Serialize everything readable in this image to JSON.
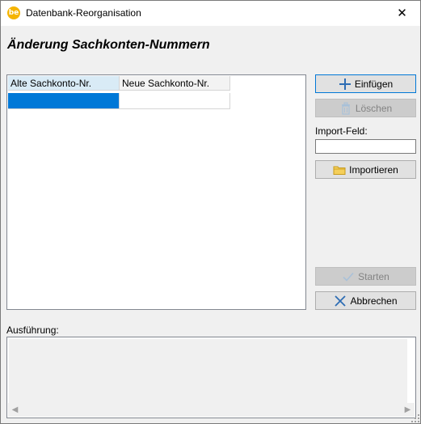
{
  "window": {
    "title": "Datenbank-Reorganisation",
    "app_icon_text": "be",
    "close_glyph": "✕"
  },
  "heading": "Änderung Sachkonten-Nummern",
  "grid": {
    "columns": [
      "Alte Sachkonto-Nr.",
      "Neue Sachkonto-Nr."
    ],
    "rows": [
      [
        "",
        ""
      ]
    ]
  },
  "buttons": {
    "insert": "Einfügen",
    "delete": "Löschen",
    "import": "Importieren",
    "start": "Starten",
    "cancel": "Abbrechen"
  },
  "import_field": {
    "label": "Import-Feld:",
    "value": ""
  },
  "execution": {
    "label": "Ausführung:",
    "text": ""
  },
  "colors": {
    "selection": "#0078d7",
    "button_border_focus": "#0078d7",
    "window_bg": "#f0f0f0",
    "header_active": "#d9ebf6"
  },
  "icons": {
    "insert": "plus-icon",
    "delete": "trash-icon",
    "import": "folder-icon",
    "start": "checkmark-icon",
    "cancel": "x-icon"
  }
}
